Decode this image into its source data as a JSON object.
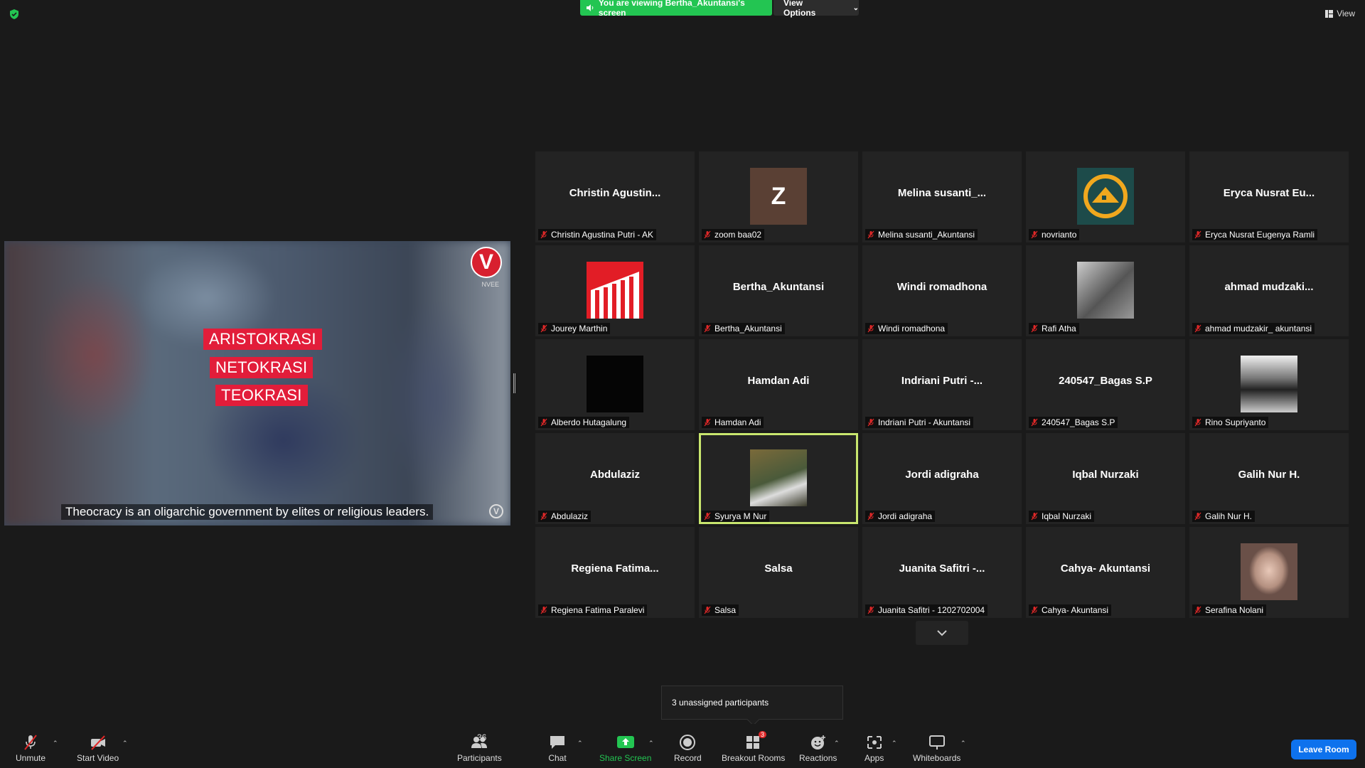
{
  "top": {
    "viewing_banner": "You are viewing Bertha_Akuntansi's screen",
    "view_options": "View Options",
    "view": "View"
  },
  "share": {
    "labels": [
      "ARISTOKRASI",
      "NETOKRASI",
      "TEOKRASI"
    ],
    "subtitle": "Theocracy is an oligarchic government by elites or religious leaders.",
    "logo_letter": "V",
    "logo_text": "NVEE",
    "colors": {
      "label_bg": "#e21d3a"
    }
  },
  "gallery": {
    "tiles": [
      {
        "name": "Christin  Agustin...",
        "label": "Christin Agustina Putri - AK",
        "avatar": "none"
      },
      {
        "name": "",
        "label": "zoom baa02",
        "avatar": "letter",
        "letter": "Z"
      },
      {
        "name": "Melina  susanti_...",
        "label": "Melina susanti_Akuntansi",
        "avatar": "none"
      },
      {
        "name": "",
        "label": "novrianto",
        "avatar": "logo-icon"
      },
      {
        "name": "Eryca Nusrat Eu...",
        "label": "Eryca Nusrat Eugenya Ramli",
        "avatar": "none"
      },
      {
        "name": "",
        "label": "Jourey Marthin",
        "avatar": "building-icon"
      },
      {
        "name": "Bertha_Akuntansi",
        "label": "Bertha_Akuntansi",
        "avatar": "none"
      },
      {
        "name": "Windi romadhona",
        "label": "Windi romadhona",
        "avatar": "none"
      },
      {
        "name": "",
        "label": "Rafi Atha",
        "avatar": "photo-bw"
      },
      {
        "name": "ahmad  mudzaki...",
        "label": "ahmad mudzakir_ akuntansi",
        "avatar": "none"
      },
      {
        "name": "",
        "label": "Alberdo Hutagalung",
        "avatar": "dark"
      },
      {
        "name": "Hamdan Adi",
        "label": "Hamdan Adi",
        "avatar": "none"
      },
      {
        "name": "Indriani  Putri  -...",
        "label": "Indriani Putri - Akuntansi",
        "avatar": "none"
      },
      {
        "name": "240547_Bagas S.P",
        "label": "240547_Bagas S.P",
        "avatar": "none"
      },
      {
        "name": "",
        "label": "Rino Supriyanto",
        "avatar": "photo-arch"
      },
      {
        "name": "Abdulaziz",
        "label": "Abdulaziz",
        "avatar": "none"
      },
      {
        "name": "",
        "label": "Syurya M Nur",
        "avatar": "photo-green",
        "active": true
      },
      {
        "name": "Jordi adigraha",
        "label": "Jordi adigraha",
        "avatar": "none"
      },
      {
        "name": "Iqbal Nurzaki",
        "label": "Iqbal Nurzaki",
        "avatar": "none"
      },
      {
        "name": "Galih Nur H.",
        "label": "Galih Nur H.",
        "avatar": "none"
      },
      {
        "name": "Regiena  Fatima...",
        "label": "Regiena Fatima Paralevi",
        "avatar": "none"
      },
      {
        "name": "Salsa",
        "label": "Salsa",
        "avatar": "none"
      },
      {
        "name": "Juanita  Safitri  -...",
        "label": "Juanita Safitri - 1202702004",
        "avatar": "none"
      },
      {
        "name": "Cahya- Akuntansi",
        "label": "Cahya- Akuntansi",
        "avatar": "none"
      },
      {
        "name": "",
        "label": "Serafina Nolani",
        "avatar": "photo-woman"
      }
    ]
  },
  "toast": {
    "text": "3 unassigned participants"
  },
  "toolbar": {
    "unmute": "Unmute",
    "start_video": "Start Video",
    "participants": "Participants",
    "participants_count": "36",
    "chat": "Chat",
    "share_screen": "Share Screen",
    "record": "Record",
    "breakout_rooms": "Breakout Rooms",
    "breakout_badge": "3",
    "reactions": "Reactions",
    "apps": "Apps",
    "whiteboards": "Whiteboards",
    "leave": "Leave Room"
  },
  "colors": {
    "accent_green": "#23c552",
    "leave_blue": "#0e72ed",
    "active_outline": "#c8e66e",
    "mic_off_red": "#e02828"
  }
}
